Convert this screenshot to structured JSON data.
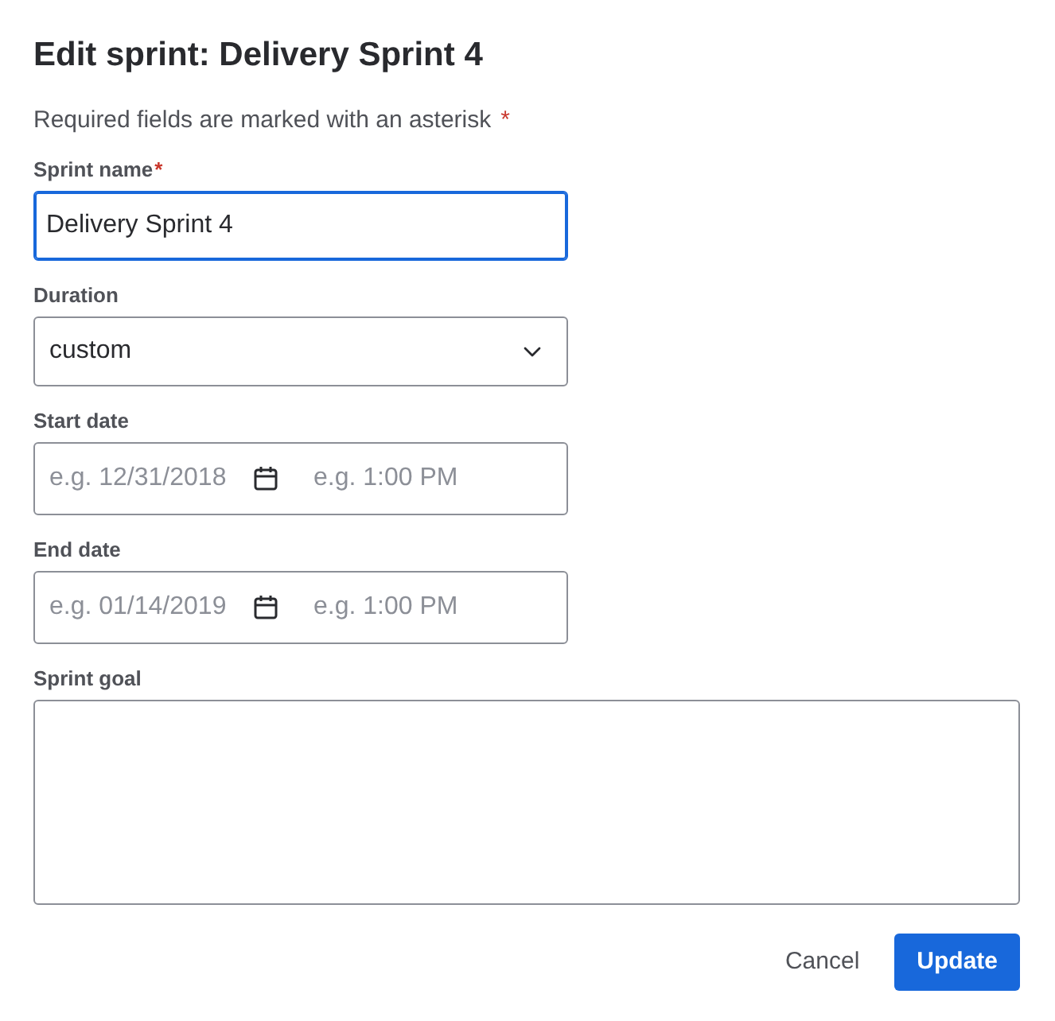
{
  "dialog": {
    "title": "Edit sprint: Delivery Sprint 4",
    "required_note": {
      "text": "Required fields are marked with an asterisk",
      "marker": "*"
    },
    "fields": [
      {
        "kind": "text",
        "label": "Sprint name",
        "required_marker": "*",
        "value": "Delivery Sprint 4",
        "focused": true
      },
      {
        "kind": "select",
        "label": "Duration",
        "value": "custom",
        "focused": false
      },
      {
        "kind": "datetime",
        "label": "Start date",
        "date_placeholder": "e.g. 12/31/2018",
        "time_placeholder": "e.g. 1:00 PM",
        "focused": false
      },
      {
        "kind": "datetime",
        "label": "End date",
        "date_placeholder": "e.g. 01/14/2019",
        "time_placeholder": "e.g. 1:00 PM",
        "focused": false
      },
      {
        "kind": "textarea",
        "label": "Sprint goal",
        "focused": false
      }
    ],
    "buttons": [
      {
        "kind": "subtle",
        "label": "Cancel"
      },
      {
        "kind": "primary",
        "label": "Update"
      }
    ]
  }
}
